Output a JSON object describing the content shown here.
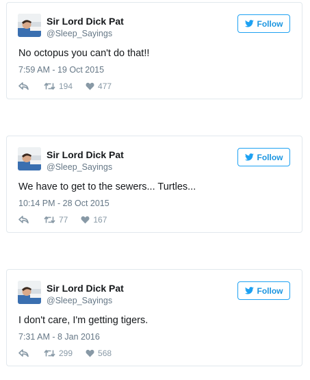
{
  "colors": {
    "accent": "#1da1f2",
    "follow_text": "#1b95e0",
    "name": "#14171a",
    "muted": "#657786",
    "action_gray": "#8899a6",
    "border": "#e1e8ed"
  },
  "icons": {
    "follow": "twitter-bird-icon",
    "reply": "reply-arrow-icon",
    "retweet": "retweet-icon",
    "like": "heart-icon"
  },
  "tweets": [
    {
      "name": "Sir Lord Dick Pat",
      "handle": "@Sleep_Sayings",
      "follow_label": "Follow",
      "text": "No octopus you can't do that!!",
      "timestamp": "7:59 AM - 19 Oct 2015",
      "retweets": "194",
      "likes": "477"
    },
    {
      "name": "Sir Lord Dick Pat",
      "handle": "@Sleep_Sayings",
      "follow_label": "Follow",
      "text": "We have to get to the sewers... Turtles...",
      "timestamp": "10:14 PM - 28 Oct 2015",
      "retweets": "77",
      "likes": "167"
    },
    {
      "name": "Sir Lord Dick Pat",
      "handle": "@Sleep_Sayings",
      "follow_label": "Follow",
      "text": "I don't care, I'm getting tigers.",
      "timestamp": "7:31 AM - 8 Jan 2016",
      "retweets": "299",
      "likes": "568"
    }
  ]
}
